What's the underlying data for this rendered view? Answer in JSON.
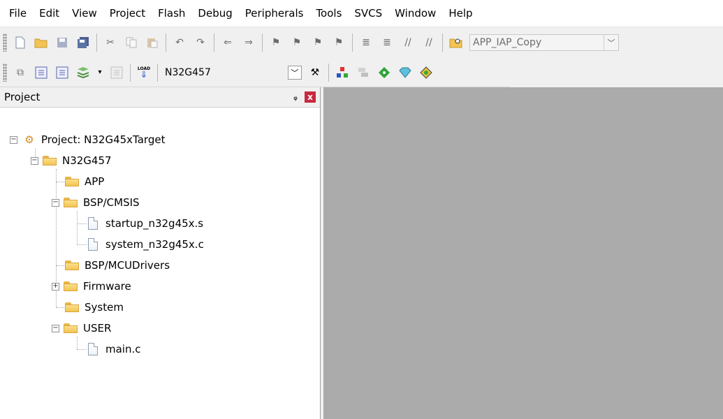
{
  "menubar": {
    "items": [
      "File",
      "Edit",
      "View",
      "Project",
      "Flash",
      "Debug",
      "Peripherals",
      "Tools",
      "SVCS",
      "Window",
      "Help"
    ]
  },
  "toolbar1": {
    "icons": [
      "new-file-icon",
      "open-folder-icon",
      "save-icon",
      "save-all-icon",
      "cut-icon",
      "copy-icon",
      "paste-icon",
      "undo-icon",
      "redo-icon",
      "navigate-back-icon",
      "navigate-forward-icon",
      "bookmark-icon",
      "bookmark-prev-icon",
      "bookmark-next-icon",
      "bookmark-clear-icon",
      "indent-icon",
      "unindent-icon",
      "comment-icon",
      "uncomment-icon",
      "find-in-files-icon"
    ],
    "combo_value": "APP_IAP_Copy"
  },
  "toolbar2": {
    "icons": [
      "translate-icon",
      "build-icon",
      "rebuild-icon",
      "batch-build-icon",
      "stop-build-icon",
      "download-icon"
    ],
    "download_label": "LOAD",
    "target_value": "N32G457",
    "right_icons": [
      "target-options-icon",
      "manage-project-icon",
      "select-packs-icon",
      "manage-rte-icon",
      "pack-installer-icon",
      "components-icon"
    ]
  },
  "project_panel": {
    "title": "Project",
    "pin_glyph": "ᵩ",
    "close_glyph": "x",
    "tree": {
      "root": "Project: N32G45xTarget",
      "target": "N32G457",
      "groups": [
        {
          "label": "APP"
        },
        {
          "label": "BSP/CMSIS",
          "files": [
            "startup_n32g45x.s",
            "system_n32g45x.c"
          ]
        },
        {
          "label": "BSP/MCUDrivers"
        },
        {
          "label": "Firmware"
        },
        {
          "label": "System"
        },
        {
          "label": "USER",
          "files": [
            "main.c"
          ]
        }
      ]
    }
  },
  "colors": {
    "workspace_bg": "#ababab",
    "close_button": "#c8283e",
    "folder": "#f3c453"
  }
}
